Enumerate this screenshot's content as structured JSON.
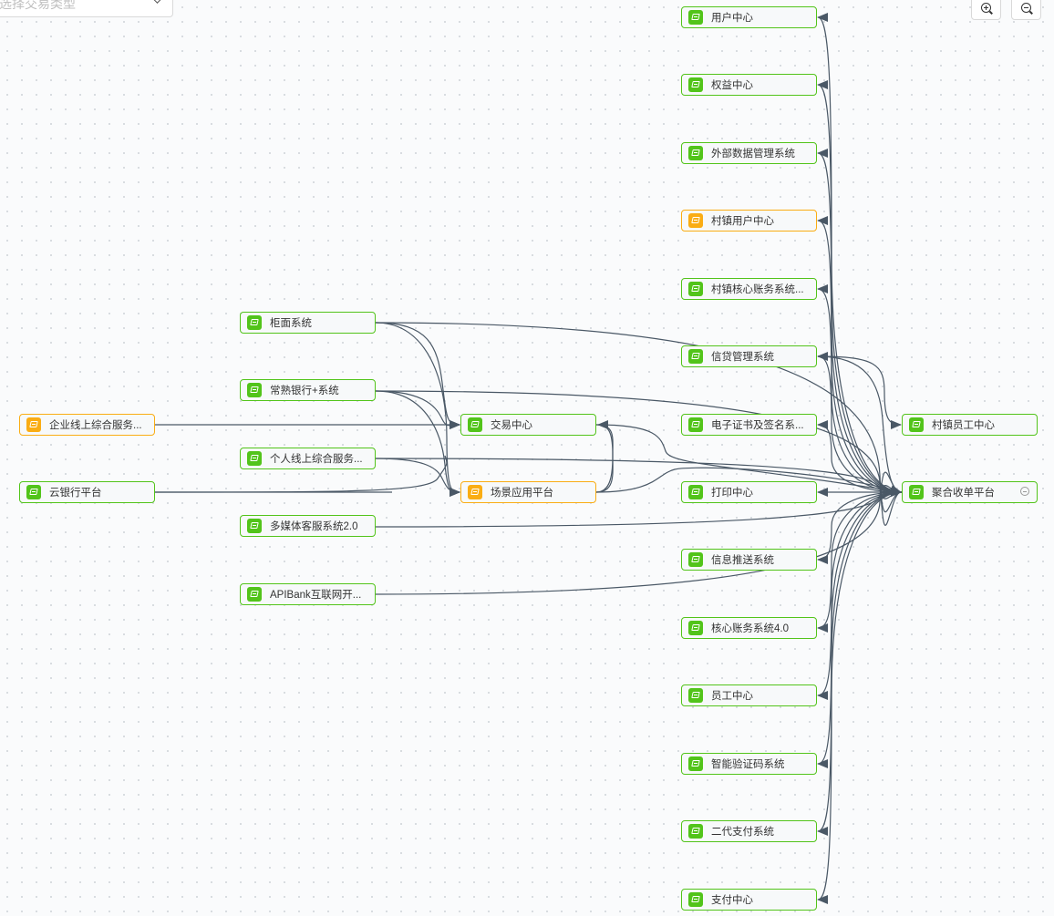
{
  "toolbar": {
    "select_placeholder": "选择交易类型",
    "zoom_in": "",
    "zoom_out": ""
  },
  "colors": {
    "system": "#52c41a",
    "highlight": "#faad14",
    "edge": "#4a5866"
  },
  "nodes": {
    "n1": "用户中心",
    "n2": "权益中心",
    "n3": "外部数据管理系统",
    "n4": "村镇用户中心",
    "n5": "村镇核心账务系统...",
    "n6": "信贷管理系统",
    "n7": "电子证书及签名系...",
    "n8": "打印中心",
    "n9": "信息推送系统",
    "n10": "核心账务系统4.0",
    "n11": "员工中心",
    "n12": "智能验证码系统",
    "n13": "二代支付系统",
    "n14": "支付中心",
    "g1": "柜面系统",
    "g2": "常熟银行+系统",
    "g3": "个人线上综合服务...",
    "g4": "多媒体客服系统2.0",
    "g5": "APIBank互联网开...",
    "l1": "企业线上综合服务...",
    "l2": "云银行平台",
    "c1": "交易中心",
    "c2": "场景应用平台",
    "r1": "村镇员工中心",
    "r2": "聚合收单平台"
  }
}
